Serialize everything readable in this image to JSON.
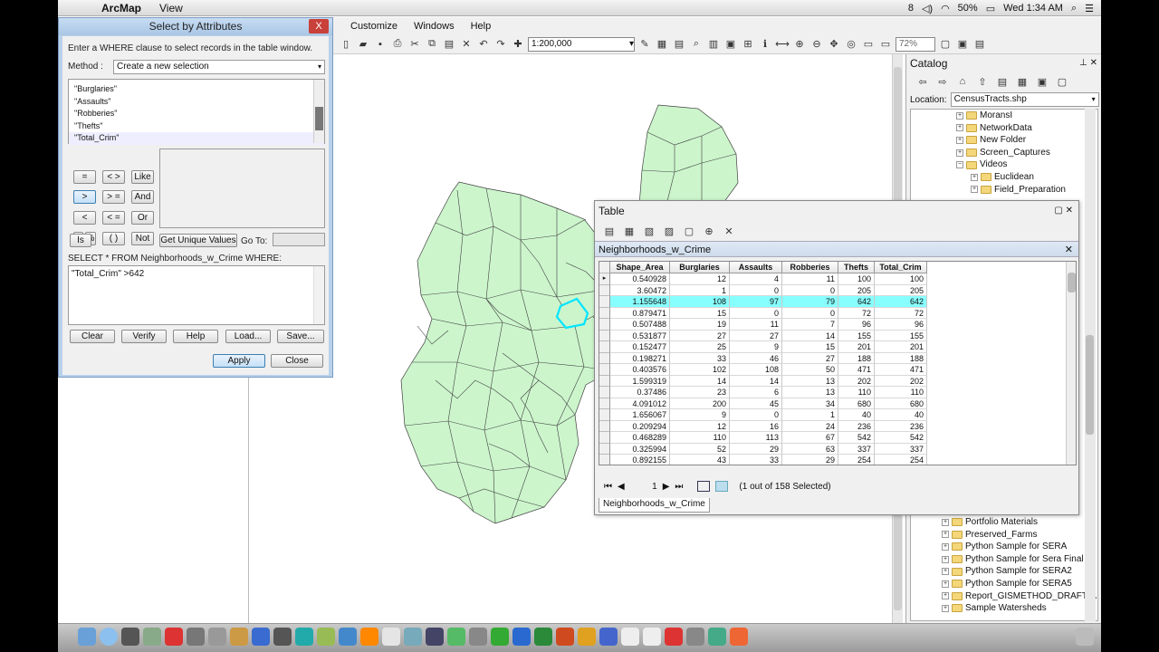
{
  "menubar": {
    "app": "ArcMap",
    "view": "View",
    "status": [
      "8",
      "50%",
      "Wed 1:34 AM"
    ]
  },
  "arcmap": {
    "menus": [
      "Customize",
      "Windows",
      "Help"
    ],
    "scale": "1:200,000",
    "zoom": "72%"
  },
  "select_by_attributes": {
    "title": "Select by Attributes",
    "close": "X",
    "instruction": "Enter a WHERE clause to select records in the table window.",
    "method_label": "Method :",
    "method_value": "Create a new selection",
    "fields": [
      "\"Burglaries\"",
      "\"Assaults\"",
      "\"Robberies\"",
      "\"Thefts\"",
      "\"Total_Crim\""
    ],
    "operators": [
      "=",
      "< >",
      "Like",
      ">",
      "> =",
      "And",
      "<",
      "< =",
      "Or",
      "_",
      "%",
      "( )",
      "Not"
    ],
    "is_button": "Is",
    "unique_button": "Get Unique Values",
    "goto_label": "Go To:",
    "select_label": "SELECT * FROM Neighborhoods_w_Crime WHERE:",
    "expression": "\"Total_Crim\" >642",
    "buttons": [
      "Clear",
      "Verify",
      "Help",
      "Load...",
      "Save..."
    ],
    "apply": "Apply",
    "close_button": "Close"
  },
  "catalog": {
    "title": "Catalog",
    "location_label": "Location:",
    "location_value": "CensusTracts.shp",
    "tree_top": [
      {
        "label": "MoransI",
        "indent": 0
      },
      {
        "label": "NetworkData",
        "indent": 0
      },
      {
        "label": "New Folder",
        "indent": 0
      },
      {
        "label": "Screen_Captures",
        "indent": 0
      },
      {
        "label": "Videos",
        "indent": 0,
        "open": true
      },
      {
        "label": "Euclidean",
        "indent": 1
      },
      {
        "label": "Field_Preparation",
        "indent": 1
      }
    ],
    "tree_bottom": [
      "Portfolio Materials",
      "Preserved_Farms",
      "Python Sample for SERA",
      "Python Sample for Sera Final",
      "Python Sample for SERA2",
      "Python Sample for SERA5",
      "Report_GISMETHOD_DRAFT(A",
      "Sample Watersheds"
    ]
  },
  "table": {
    "title": "Table",
    "tab_name": "Neighborhoods_w_Crime",
    "columns": [
      "Shape_Area",
      "Burglaries",
      "Assaults",
      "Robberies",
      "Thefts",
      "Total_Crim"
    ],
    "rows": [
      [
        "0.540928",
        "12",
        "4",
        "11",
        "100",
        "100"
      ],
      [
        "3.60472",
        "1",
        "0",
        "0",
        "205",
        "205"
      ],
      [
        "1.155648",
        "108",
        "97",
        "79",
        "642",
        "642"
      ],
      [
        "0.879471",
        "15",
        "0",
        "0",
        "72",
        "72"
      ],
      [
        "0.507488",
        "19",
        "11",
        "7",
        "96",
        "96"
      ],
      [
        "0.531877",
        "27",
        "27",
        "14",
        "155",
        "155"
      ],
      [
        "0.152477",
        "25",
        "9",
        "15",
        "201",
        "201"
      ],
      [
        "0.198271",
        "33",
        "46",
        "27",
        "188",
        "188"
      ],
      [
        "0.403576",
        "102",
        "108",
        "50",
        "471",
        "471"
      ],
      [
        "1.599319",
        "14",
        "14",
        "13",
        "202",
        "202"
      ],
      [
        "0.37486",
        "23",
        "6",
        "13",
        "110",
        "110"
      ],
      [
        "4.091012",
        "200",
        "45",
        "34",
        "680",
        "680"
      ],
      [
        "1.656067",
        "9",
        "0",
        "1",
        "40",
        "40"
      ],
      [
        "0.209294",
        "12",
        "16",
        "24",
        "236",
        "236"
      ],
      [
        "0.468289",
        "110",
        "113",
        "67",
        "542",
        "542"
      ],
      [
        "0.325994",
        "52",
        "29",
        "63",
        "337",
        "337"
      ],
      [
        "0.892155",
        "43",
        "33",
        "29",
        "254",
        "254"
      ]
    ],
    "highlighted_row": 2,
    "current_record": "1",
    "selection_status": "(1 out of 158 Selected)",
    "bottom_tab": "Neighborhoods_w_Crime"
  },
  "colors": {
    "polygon_fill": "#ccf5cc",
    "polygon_stroke": "#404040",
    "selected_outline": "#00e5ff",
    "highlight_row": "#88ffff"
  }
}
